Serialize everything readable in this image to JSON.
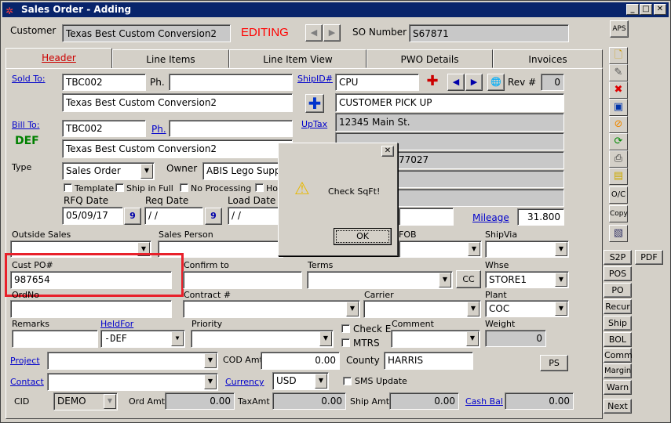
{
  "window": {
    "title": "Sales Order - Adding",
    "minimize": "_",
    "maximize": "□",
    "close": "✕"
  },
  "header": {
    "customer_label": "Customer",
    "customer_value": "Texas Best Custom Conversion2",
    "status": "EDITING",
    "so_label": "SO Number",
    "so_value": "S67871",
    "aps": "APS"
  },
  "tabs": [
    "Header",
    "Line Items",
    "Line Item View",
    "PWO Details",
    "Invoices"
  ],
  "sold_to": {
    "label": "Sold To:",
    "code": "TBC002",
    "ph_label": "Ph.",
    "phone": "",
    "name": "Texas Best Custom Conversion2"
  },
  "ship": {
    "label": "ShipID#",
    "code": "CPU",
    "rev_label": "Rev #",
    "rev": "0",
    "name": "CUSTOMER PICK UP",
    "addr1": "12345 Main St.",
    "uptax": "UpTax",
    "partial_zip": "77027"
  },
  "bill_to": {
    "label": "Bill To:",
    "code": "TBC002",
    "ph_label": "Ph.",
    "phone": "",
    "name": "Texas Best Custom Conversion2",
    "def": "DEF"
  },
  "type": {
    "label": "Type",
    "value": "Sales Order",
    "owner_label": "Owner",
    "owner_value": "ABIS Lego Supp"
  },
  "checks": {
    "template": "Template",
    "ship_full": "Ship in Full",
    "no_processing": "No Processing",
    "hold": "Ho"
  },
  "dates": {
    "rfq_label": "RFQ Date",
    "rfq": "05/09/17",
    "req_label": "Req Date",
    "req": "/ /",
    "load_label": "Load Date",
    "load": "/ /",
    "cal": "9"
  },
  "mileage": {
    "label": "Mileage",
    "value": "31.800"
  },
  "fields": {
    "outside_sales": "Outside Sales",
    "sales_person": "Sales Person",
    "fob": "FOB",
    "ship_via": "ShipVia",
    "cust_po_label": "Cust PO#",
    "cust_po": "987654",
    "confirm_to": "Confirm to",
    "terms": "Terms",
    "cc": "CC",
    "whse_label": "Whse",
    "whse": "STORE1",
    "ordno": "OrdNo",
    "contract": "Contract #",
    "carrier": "Carrier",
    "plant_label": "Plant",
    "plant": "COC",
    "remarks": "Remarks",
    "held_for": "HeldFor",
    "held_value": "-DEF",
    "priority": "Priority",
    "check_e": "Check E",
    "mtrs": "MTRS",
    "comment": "Comment",
    "weight_label": "Weight",
    "weight": "0",
    "project": "Project",
    "cod_label": "COD Amt",
    "cod": "0.00",
    "county_label": "County",
    "county": "HARRIS",
    "ps": "PS",
    "contact": "Contact",
    "currency_label": "Currency",
    "currency": "USD",
    "sms": "SMS Update",
    "cid_label": "CID",
    "cid": "DEMO",
    "ord_amt_label": "Ord Amt",
    "ord_amt": "0.00",
    "tax_label": "TaxAmt",
    "tax": "0.00",
    "ship_amt_label": "Ship Amt",
    "ship_amt": "0.00",
    "cash_bal_label": "Cash Bal",
    "cash_bal": "0.00"
  },
  "side": {
    "oc": "O/C",
    "copy": "Copy",
    "s2p": "S2P",
    "pdf": "PDF",
    "pos": "POS",
    "po": "PO",
    "recur": "Recur",
    "ship": "Ship",
    "bol": "BOL",
    "comm": "Comm",
    "margin": "Margin",
    "warn": "Warn",
    "next": "Next"
  },
  "dialog": {
    "close": "✕",
    "message": "Check SqFt!",
    "ok": "OK"
  },
  "colors": {
    "title_bg": "#08246b",
    "editing": "#ff0000",
    "link": "#0000cc",
    "def": "#008000",
    "highlight": "#e8202a"
  }
}
